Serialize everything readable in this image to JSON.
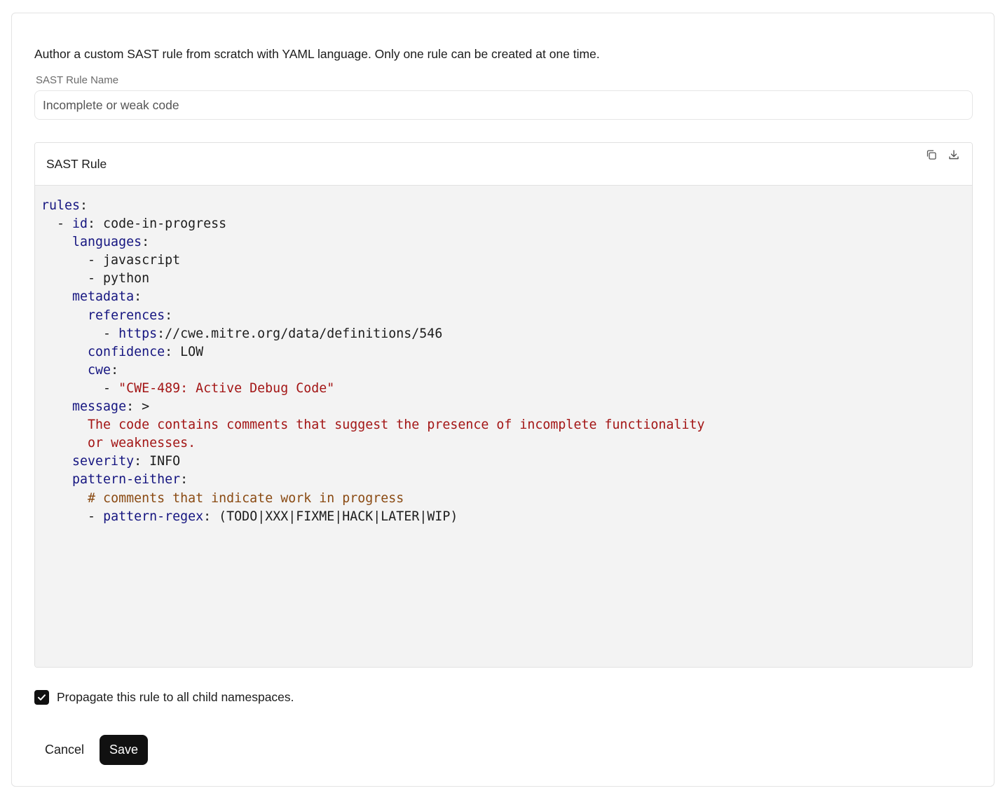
{
  "intro_text": "Author a custom SAST rule from scratch with YAML language. Only one rule can be created at one time.",
  "rule_name": {
    "label": "SAST Rule Name",
    "value": "Incomplete or weak code"
  },
  "editor": {
    "title": "SAST Rule",
    "icons": [
      "copy-icon",
      "download-icon"
    ],
    "code_lines": [
      "rules:",
      "  - id: code-in-progress",
      "    languages:",
      "      - javascript",
      "      - python",
      "    metadata:",
      "      references:",
      "        - https://cwe.mitre.org/data/definitions/546",
      "      confidence: LOW",
      "      cwe:",
      "        - \"CWE-489: Active Debug Code\"",
      "    message: >",
      "      The code contains comments that suggest the presence of incomplete functionality",
      "      or weaknesses.",
      "    severity: INFO",
      "    pattern-either:",
      "      # comments that indicate work in progress",
      "      - pattern-regex: (TODO|XXX|FIXME|HACK|LATER|WIP)"
    ]
  },
  "propagate": {
    "checked": true,
    "label": "Propagate this rule to all child namespaces."
  },
  "buttons": {
    "cancel": "Cancel",
    "save": "Save"
  },
  "colors": {
    "yaml_key": "#151580",
    "yaml_string": "#a31515",
    "yaml_comment": "#8a4a12",
    "primary_button": "#111111"
  }
}
